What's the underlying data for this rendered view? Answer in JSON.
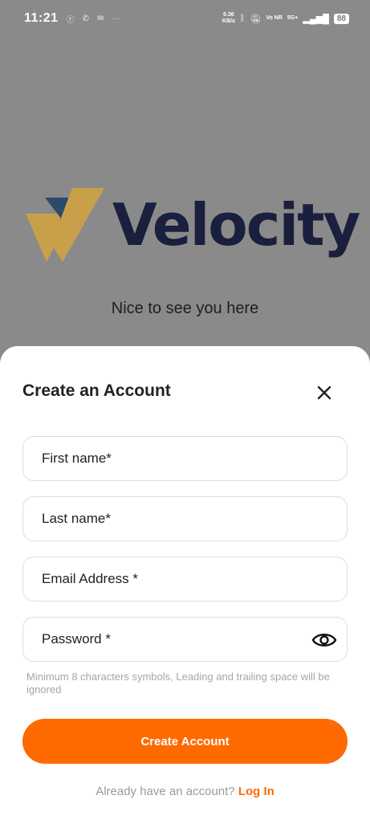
{
  "status_bar": {
    "time": "11:21",
    "speed_value": "0.36",
    "speed_unit": "KB/s",
    "network": "5G+",
    "volte": "Vo NR",
    "battery": "88"
  },
  "brand": {
    "name": "Velocity",
    "tagline": "Nice to see you here",
    "colors": {
      "navy": "#1a1f3d",
      "gold": "#c9a04a",
      "slate": "#2c4a6b"
    }
  },
  "sheet": {
    "title": "Create an Account",
    "fields": {
      "first_name": "First name*",
      "last_name": "Last name*",
      "email": "Email Address *",
      "password": "Password *"
    },
    "password_hint": "Minimum 8 characters symbols, Leading and trailing space will be ignored",
    "create_button": "Create Account",
    "login_prompt": "Already have an account?",
    "login_link": "Log In",
    "accent_color": "#ff6a00"
  },
  "icons": [
    "facebook-icon",
    "whatsapp-icon",
    "message-icon",
    "more-icon",
    "bluetooth-icon",
    "mute-icon",
    "signal-icon",
    "battery-icon",
    "close-icon",
    "eye-icon"
  ]
}
